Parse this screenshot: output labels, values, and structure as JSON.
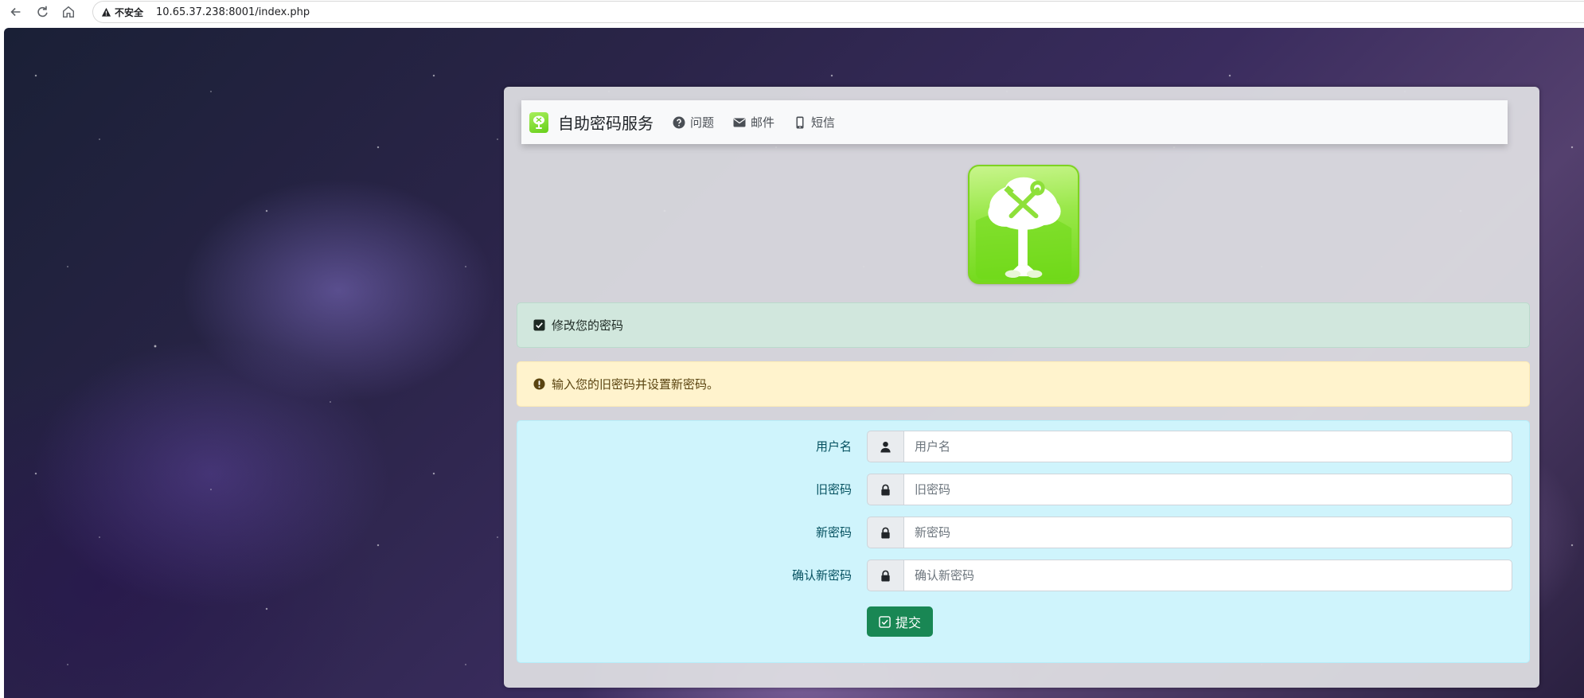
{
  "browser": {
    "security_label": "不安全",
    "url": "10.65.37.238:8001/index.php"
  },
  "navbar": {
    "brand": "自助密码服务",
    "items": [
      {
        "label": "问题",
        "icon": "question-circle-icon"
      },
      {
        "label": "邮件",
        "icon": "envelope-icon"
      },
      {
        "label": "短信",
        "icon": "mobile-phone-icon"
      }
    ]
  },
  "alerts": {
    "success": {
      "text": "修改您的密码",
      "icon": "check-square-icon"
    },
    "warning": {
      "text": "输入您的旧密码并设置新密码。",
      "icon": "exclamation-circle-icon"
    }
  },
  "form": {
    "fields": [
      {
        "label": "用户名",
        "placeholder": "用户名",
        "icon": "user-icon",
        "value": ""
      },
      {
        "label": "旧密码",
        "placeholder": "旧密码",
        "icon": "lock-icon",
        "value": ""
      },
      {
        "label": "新密码",
        "placeholder": "新密码",
        "icon": "lock-icon",
        "value": ""
      },
      {
        "label": "确认新密码",
        "placeholder": "确认新密码",
        "icon": "lock-icon",
        "value": ""
      }
    ],
    "submit_label": "提交"
  },
  "colors": {
    "submit_button": "#198754",
    "form_panel": "#cff4fc",
    "success_alert": "#d1e7dd",
    "warning_alert": "#fff3cd",
    "logo_green": "#7ed321"
  }
}
